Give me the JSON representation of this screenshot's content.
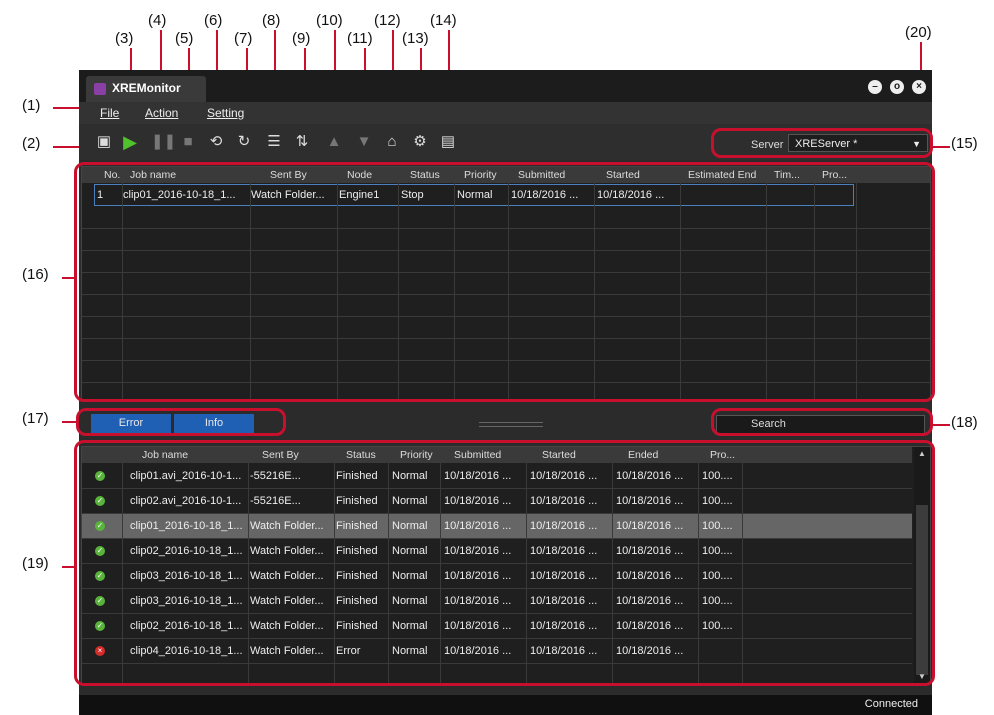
{
  "callouts": [
    "(1)",
    "(2)",
    "(3)",
    "(4)",
    "(5)",
    "(6)",
    "(7)",
    "(8)",
    "(9)",
    "(10)",
    "(11)",
    "(12)",
    "(13)",
    "(14)",
    "(15)",
    "(16)",
    "(17)",
    "(18)",
    "(19)",
    "(20)"
  ],
  "window": {
    "title": "XREMonitor",
    "icon": "app-logo-icon"
  },
  "menu": {
    "file": "File",
    "action": "Action",
    "settings": "Setting"
  },
  "toolbar_icons": [
    "copy-icon",
    "play-icon",
    "pause-icon",
    "stop-icon",
    "reset-icon",
    "refresh-icon",
    "list-icon",
    "import-icon",
    "up-icon",
    "down-icon",
    "job-icon",
    "job-settings-icon",
    "folder-icon"
  ],
  "server": {
    "label": "Server",
    "value": "XREServer *"
  },
  "top_grid": {
    "columns": [
      "No.",
      "Job name",
      "Sent By",
      "Node",
      "Status",
      "Priority",
      "Submitted",
      "Started",
      "Estimated End",
      "Tim...",
      "Pro..."
    ],
    "rows": [
      [
        "1",
        "clip01_2016-10-18_1...",
        "Watch Folder...",
        "Engine1",
        "Stop",
        "Normal",
        "10/18/2016 ...",
        "10/18/2016 ...",
        "",
        "",
        ""
      ]
    ]
  },
  "tabs": {
    "error": "Error",
    "info": "Info"
  },
  "search": {
    "label": "Search"
  },
  "bottom_grid": {
    "columns": [
      "Job name",
      "Sent By",
      "Status",
      "Priority",
      "Submitted",
      "Started",
      "Ended",
      "Pro..."
    ],
    "rows": [
      {
        "icon": "ok",
        "cells": [
          "clip01.avi_2016-10-1...",
          "-55216E...",
          "Finished",
          "Normal",
          "10/18/2016 ...",
          "10/18/2016 ...",
          "10/18/2016 ...",
          "100...."
        ]
      },
      {
        "icon": "ok",
        "cells": [
          "clip02.avi_2016-10-1...",
          "-55216E...",
          "Finished",
          "Normal",
          "10/18/2016 ...",
          "10/18/2016 ...",
          "10/18/2016 ...",
          "100...."
        ]
      },
      {
        "icon": "ok",
        "cells": [
          "clip01_2016-10-18_1...",
          "Watch Folder...",
          "Finished",
          "Normal",
          "10/18/2016 ...",
          "10/18/2016 ...",
          "10/18/2016 ...",
          "100...."
        ]
      },
      {
        "icon": "ok",
        "cells": [
          "clip02_2016-10-18_1...",
          "Watch Folder...",
          "Finished",
          "Normal",
          "10/18/2016 ...",
          "10/18/2016 ...",
          "10/18/2016 ...",
          "100...."
        ]
      },
      {
        "icon": "ok",
        "cells": [
          "clip03_2016-10-18_1...",
          "Watch Folder...",
          "Finished",
          "Normal",
          "10/18/2016 ...",
          "10/18/2016 ...",
          "10/18/2016 ...",
          "100...."
        ]
      },
      {
        "icon": "ok",
        "cells": [
          "clip03_2016-10-18_1...",
          "Watch Folder...",
          "Finished",
          "Normal",
          "10/18/2016 ...",
          "10/18/2016 ...",
          "10/18/2016 ...",
          "100...."
        ]
      },
      {
        "icon": "ok",
        "cells": [
          "clip02_2016-10-18_1...",
          "Watch Folder...",
          "Finished",
          "Normal",
          "10/18/2016 ...",
          "10/18/2016 ...",
          "10/18/2016 ...",
          "100...."
        ]
      },
      {
        "icon": "err",
        "cells": [
          "clip04_2016-10-18_1...",
          "Watch Folder...",
          "Error",
          "Normal",
          "10/18/2016 ...",
          "10/18/2016 ...",
          "10/18/2016 ...",
          ""
        ]
      }
    ]
  },
  "status": {
    "text": "Connected"
  },
  "colors": {
    "accent": "#c8102e",
    "tab_blue": "#1f5fb4",
    "ok_green": "#58b43a",
    "error_red": "#d62b2b"
  }
}
